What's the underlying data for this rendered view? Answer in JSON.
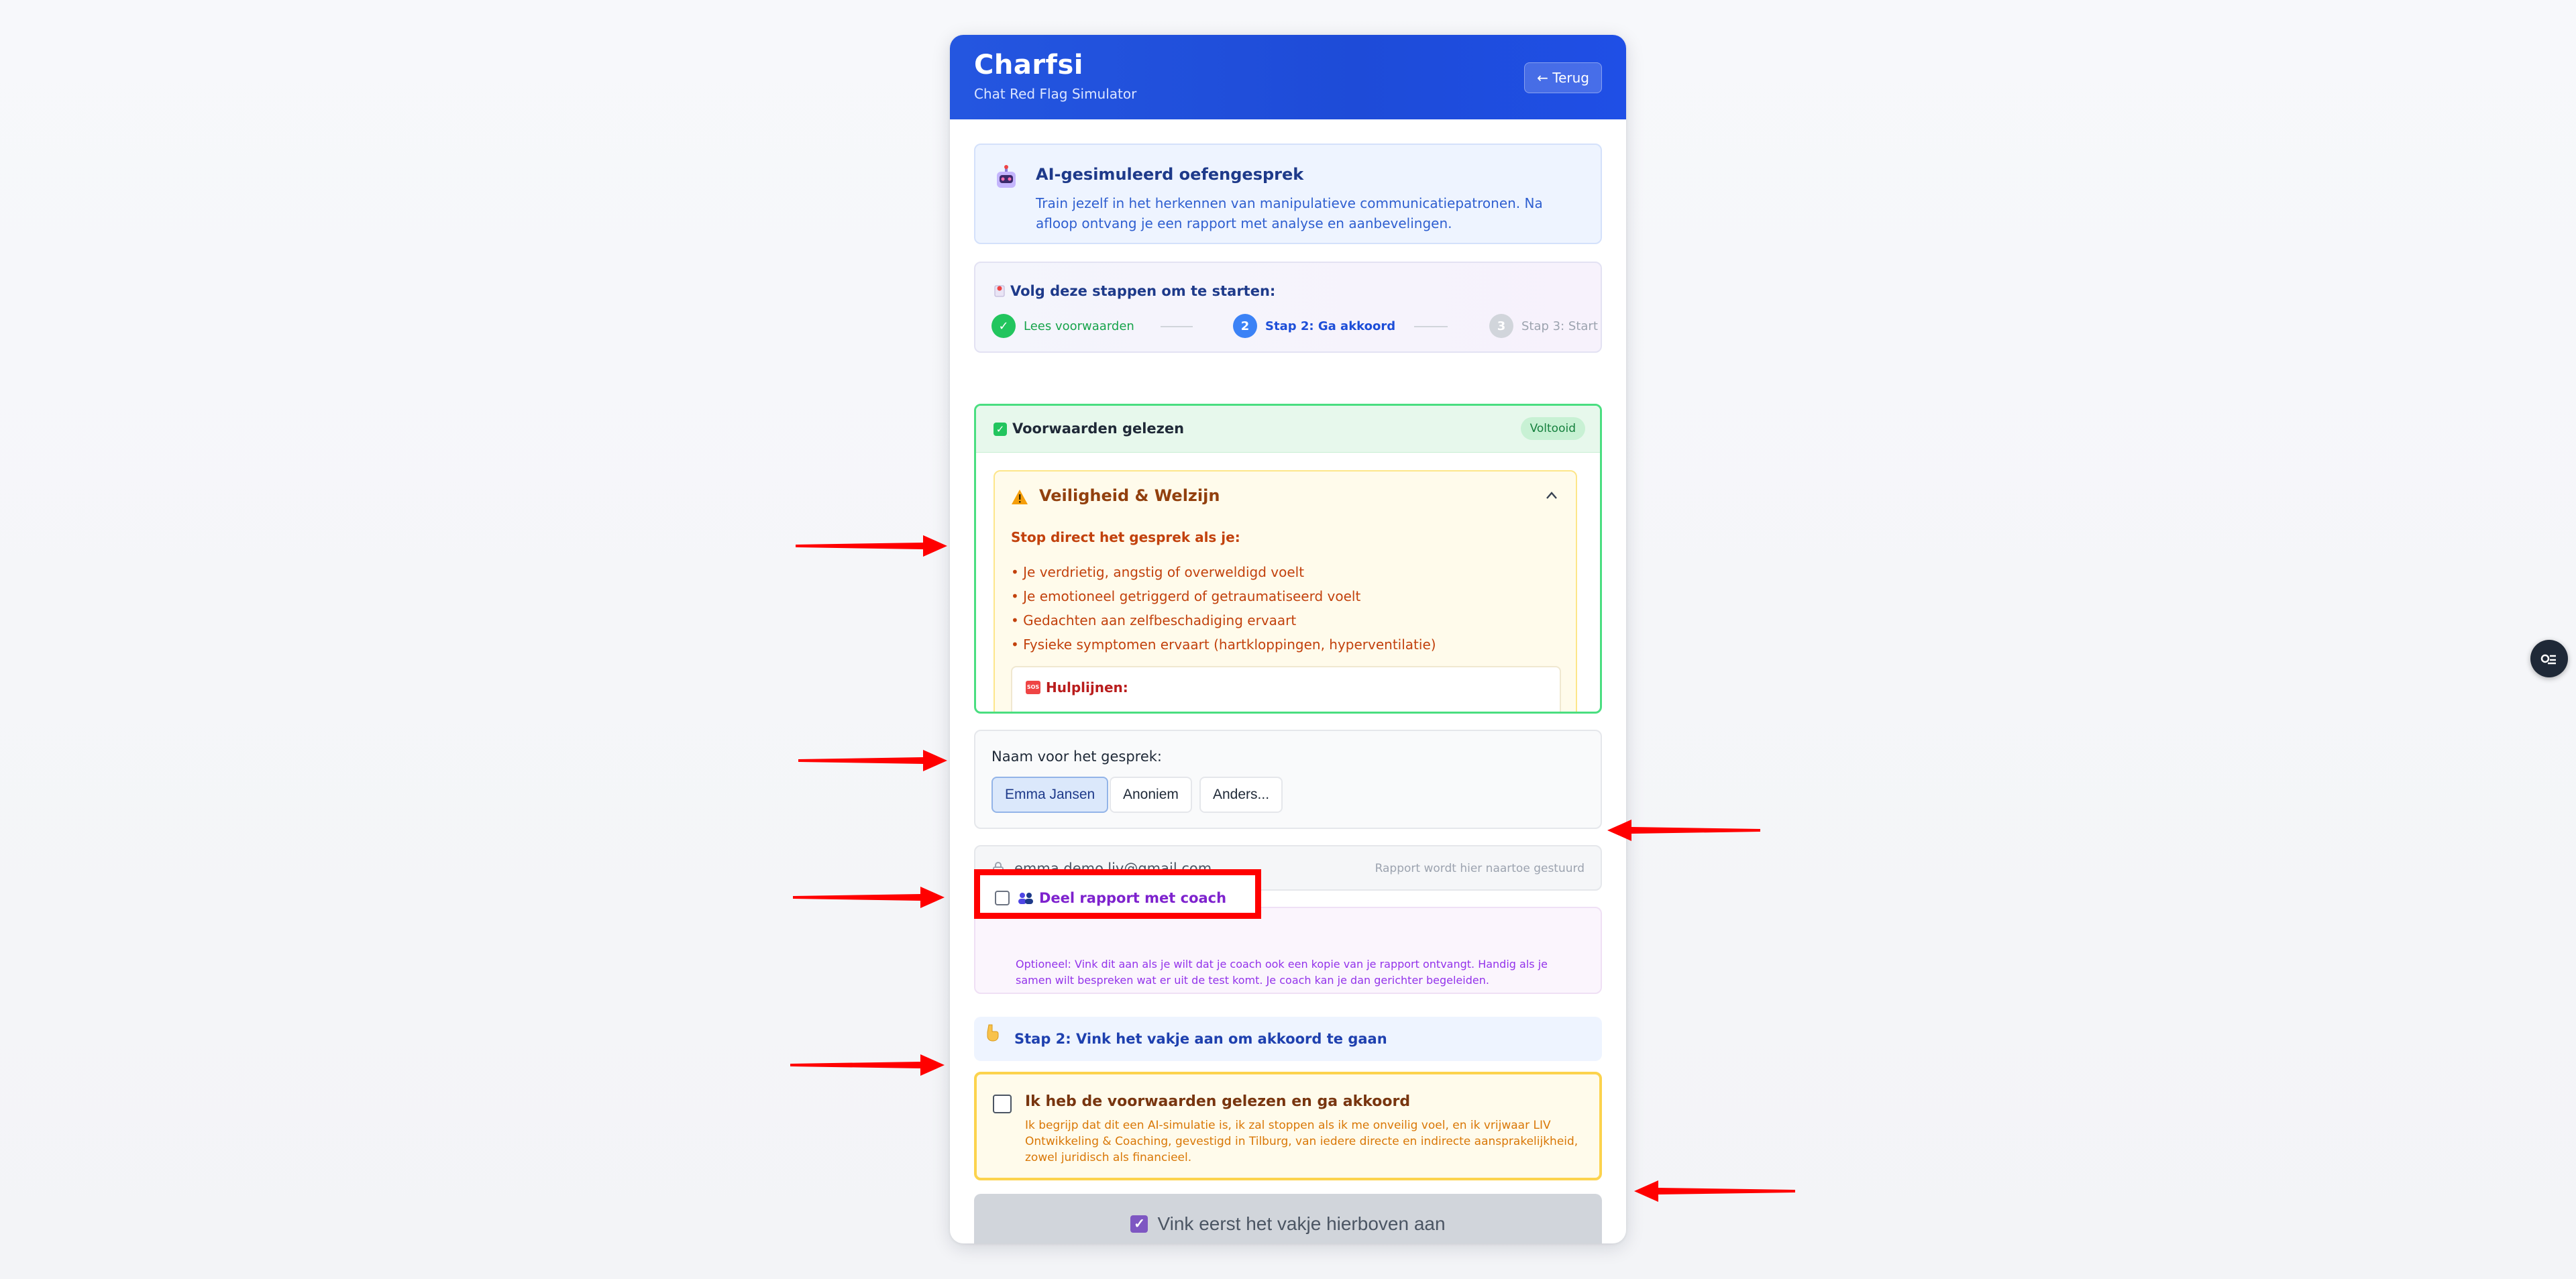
{
  "header": {
    "title": "Charfsi",
    "subtitle": "Chat Red Flag Simulator",
    "back_label": "← Terug"
  },
  "intro": {
    "title": "AI-gesimuleerd oefengesprek",
    "text": "Train jezelf in het herkennen van manipulatieve communicatiepatronen. Na afloop ontvang je een rapport met analyse en aanbevelingen."
  },
  "steps": {
    "title": "Volg deze stappen om te starten:",
    "items": [
      {
        "marker": "✓",
        "label": "Lees voorwaarden",
        "state": "done"
      },
      {
        "marker": "2",
        "label": "Stap 2: Ga akkoord",
        "state": "active"
      },
      {
        "marker": "3",
        "label": "Stap 3: Start",
        "state": "pending"
      }
    ]
  },
  "conditions": {
    "title": "Voorwaarden gelezen",
    "badge": "Voltooid",
    "safety_title": "Veiligheid & Welzijn",
    "stop_title": "Stop direct het gesprek als je:",
    "stop_items": [
      "• Je verdrietig, angstig of overweldigd voelt",
      "• Je emotioneel getriggerd of getraumatiseerd voelt",
      "• Gedachten aan zelfbeschadiging ervaart",
      "• Fysieke symptomen ervaart (hartkloppingen, hyperventilatie)"
    ],
    "help_title": "Hulplijnen:",
    "help_icon": "SOS"
  },
  "name_select": {
    "label": "Naam voor het gesprek:",
    "options": [
      "Emma Jansen",
      "Anoniem",
      "Anders..."
    ],
    "selected": "Emma Jansen"
  },
  "email": {
    "value": "emma.demo.liv@gmail.com",
    "hint": "Rapport wordt hier naartoe gestuurd"
  },
  "coach": {
    "label": "Deel rapport met coach",
    "text": "Optioneel: Vink dit aan als je wilt dat je coach ook een kopie van je rapport ontvangt. Handig als je samen wilt bespreken wat er uit de test komt. Je coach kan je dan gerichter begeleiden.",
    "checked": false
  },
  "step2_hint": "Stap 2: Vink het vakje aan om akkoord te gaan",
  "agree": {
    "title": "Ik heb de voorwaarden gelezen en ga akkoord",
    "text": "Ik begrijp dat dit een AI-simulatie is, ik zal stoppen als ik me onveilig voel, en ik vrijwaar LIV Ontwikkeling & Coaching, gevestigd in Tilburg, van iedere directe en indirecte aansprakelijkheid, zowel juridisch als financieel.",
    "checked": false
  },
  "submit_label": "Vink eerst het vakje hierboven aan",
  "colors": {
    "header_blue": "#1e4bd8",
    "success_green": "#22c55e",
    "warning_orange": "#c2410c",
    "annotation_red": "#ff0000"
  }
}
